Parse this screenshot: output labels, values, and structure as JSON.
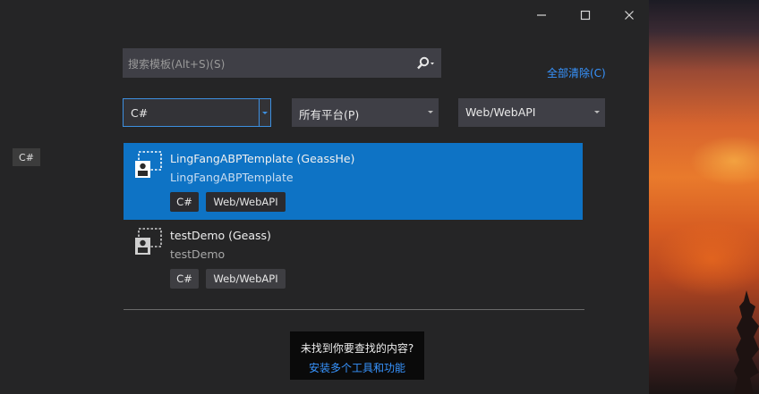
{
  "window_controls": {
    "minimize": "─",
    "maximize": "☐",
    "close": "✕"
  },
  "search": {
    "placeholder": "搜索模板(Alt+S)(S)"
  },
  "clear_all": "全部清除(C)",
  "filters": {
    "language": "C#",
    "platform": "所有平台(P)",
    "project_type": "Web/WebAPI"
  },
  "side_tag": "C#",
  "templates": [
    {
      "name": "LingFangABPTemplate (GeassHe)",
      "subtitle": "LingFangABPTemplate",
      "tags": [
        "C#",
        "Web/WebAPI"
      ],
      "selected": true
    },
    {
      "name": "testDemo (Geass)",
      "subtitle": "testDemo",
      "tags": [
        "C#",
        "Web/WebAPI"
      ],
      "selected": false
    }
  ],
  "not_found": {
    "question": "未找到你要查找的内容?",
    "link": "安装多个工具和功能"
  },
  "colors": {
    "accent": "#0e73c5",
    "link": "#3794ff",
    "background": "#252526"
  },
  "icons": {
    "search": "search-icon",
    "template": "template-icon",
    "caret": "chevron-down-icon"
  }
}
